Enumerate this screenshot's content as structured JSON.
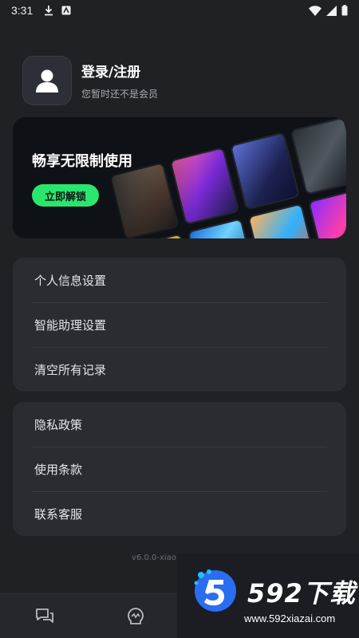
{
  "status_bar": {
    "time": "3:31"
  },
  "profile": {
    "title": "登录/注册",
    "subtitle": "您暂时还不是会员"
  },
  "banner": {
    "title": "畅享无限制使用",
    "button_label": "立即解锁",
    "accent_color": "#2ae66f"
  },
  "menu_group_1": [
    {
      "label": "个人信息设置"
    },
    {
      "label": "智能助理设置"
    },
    {
      "label": "清空所有记录"
    }
  ],
  "menu_group_2": [
    {
      "label": "隐私政策"
    },
    {
      "label": "使用条款"
    },
    {
      "label": "联系客服"
    }
  ],
  "version": "v6.0.0-xiao",
  "bottom_nav": [
    {
      "icon": "chat-icon"
    },
    {
      "icon": "brain-icon"
    }
  ],
  "watermark": {
    "title": "592下载",
    "url": "www.592xiazai.com"
  }
}
